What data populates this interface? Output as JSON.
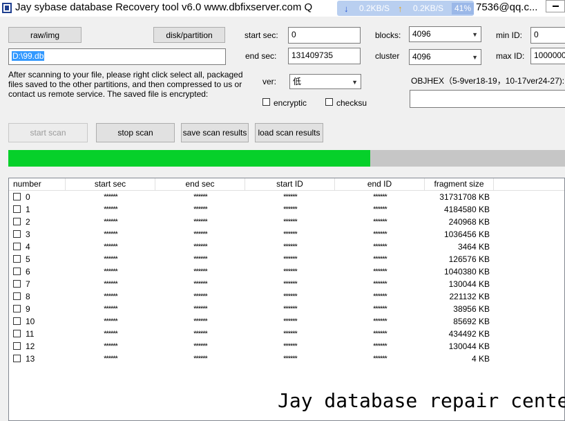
{
  "window": {
    "title": "Jay sybase database Recovery tool  v6.0 www.dbfixserver.com Q",
    "title_tail": "7536@qq.c...",
    "minimize_glyph": "—"
  },
  "net_monitor": {
    "down_rate": "0.2KB/S",
    "up_rate": "0.2KB/S",
    "percent": "41%"
  },
  "toolbar": {
    "raw_img_label": "raw/img",
    "disk_partition_label": "disk/partition",
    "path_value": "D:\\99.db",
    "info_text": "After scanning to your file, please right click select all, packaged files saved to the other partitions, and then compressed to us or contact us remote service. The saved file is encrypted:",
    "start_sec_label": "start sec:",
    "start_sec_value": "0",
    "end_sec_label": "end sec:",
    "end_sec_value": "131409735",
    "ver_label": "ver:",
    "ver_value": "低",
    "encryptic_label": "encryptic",
    "checksum_label": "checksu",
    "blocks_label": "blocks:",
    "blocks_value": "4096",
    "cluster_label": "cluster",
    "cluster_value": "4096",
    "min_id_label": "min ID:",
    "min_id_value": "0",
    "max_id_label": "max ID:",
    "max_id_value": "1000000",
    "objhex_label": "OBJHEX（5-9ver18-19，10-17ver24-27):",
    "objhex_value": ""
  },
  "actions": {
    "start_scan": "start scan",
    "stop_scan": "stop scan",
    "save_scan_results": "save scan results",
    "load_scan_results": "load scan results"
  },
  "progress": {
    "fraction": 0.65
  },
  "table": {
    "columns": [
      "number",
      "start sec",
      "end sec",
      "start ID",
      "end ID",
      "fragment size"
    ],
    "mask": "******",
    "rows": [
      {
        "number": "0",
        "size": "31731708 KB"
      },
      {
        "number": "1",
        "size": "4184580 KB"
      },
      {
        "number": "2",
        "size": "240968 KB"
      },
      {
        "number": "3",
        "size": "1036456 KB"
      },
      {
        "number": "4",
        "size": "3464 KB"
      },
      {
        "number": "5",
        "size": "126576 KB"
      },
      {
        "number": "6",
        "size": "1040380 KB"
      },
      {
        "number": "7",
        "size": "130044 KB"
      },
      {
        "number": "8",
        "size": "221132 KB"
      },
      {
        "number": "9",
        "size": "38956 KB"
      },
      {
        "number": "10",
        "size": "85692 KB"
      },
      {
        "number": "11",
        "size": "434492 KB"
      },
      {
        "number": "12",
        "size": "130044 KB"
      },
      {
        "number": "13",
        "size": "4 KB"
      }
    ]
  },
  "watermark": "Jay database repair center",
  "colors": {
    "progress_fill": "#06d02a",
    "progress_track": "#c6c6c6",
    "selection": "#3399ff"
  }
}
